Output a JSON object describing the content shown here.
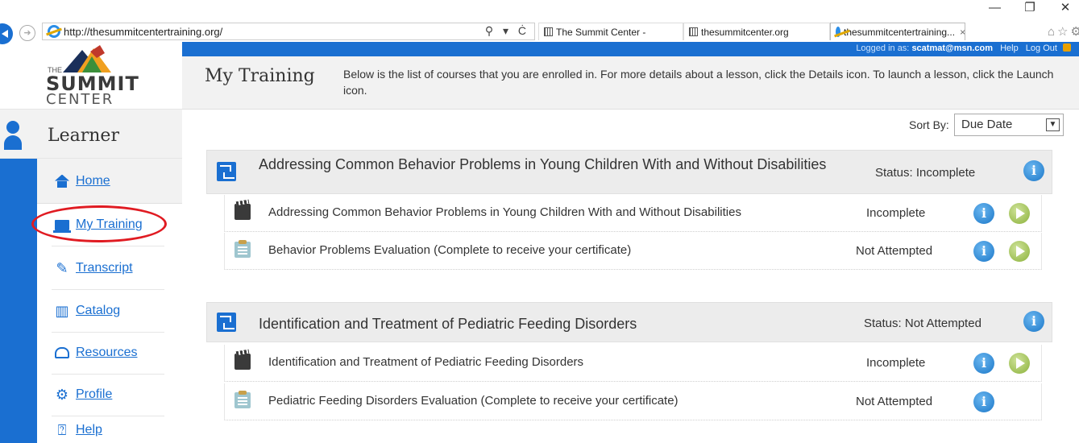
{
  "browser": {
    "url": "http://thesummitcentertraining.org/",
    "tabs": [
      {
        "label": "The Summit Center -"
      },
      {
        "label": "thesummitcenter.org"
      },
      {
        "label": "thesummitcentertraining...",
        "close": "×"
      }
    ],
    "window_controls": {
      "minimize": "—",
      "restore": "❐",
      "close": "✕"
    },
    "address_tools": "⚲ ▾ Ċ",
    "toolbar_icons": "⌂☆⚙"
  },
  "topbar": {
    "logged_in_prefix": "Logged in as: ",
    "user_email": "scatmat@msn.com",
    "help": "Help",
    "logout": "Log Out"
  },
  "logo": {
    "the": "THE",
    "summit": "SUMMIT",
    "center": "CENTER"
  },
  "sidebar": {
    "section_title": "Learner",
    "items": [
      {
        "label": "Home",
        "icon": "house-icon"
      },
      {
        "label": "My Training",
        "icon": "laptop-icon"
      },
      {
        "label": "Transcript",
        "icon": "transcript-icon"
      },
      {
        "label": "Catalog",
        "icon": "catalog-icon"
      },
      {
        "label": "Resources",
        "icon": "cloud-icon"
      },
      {
        "label": "Profile",
        "icon": "gear-icon"
      },
      {
        "label": "Help",
        "icon": "help-icon"
      }
    ]
  },
  "page": {
    "title": "My Training",
    "description": "Below is the list of courses that you are enrolled in. For more details about a lesson, click the Details icon. To launch a lesson, click the Launch icon.",
    "sort_label": "Sort By:",
    "sort_value": "Due Date"
  },
  "courses": [
    {
      "title": "Addressing Common Behavior Problems in Young Children With and Without Disabilities",
      "status": "Status: Incomplete",
      "lessons": [
        {
          "title": "Addressing Common Behavior Problems in Young Children With and Without Disabilities",
          "status": "Incomplete",
          "type": "video",
          "launch": true
        },
        {
          "title": "Behavior Problems Evaluation (Complete to receive your certificate)",
          "status": "Not Attempted",
          "type": "evaluation",
          "launch": true
        }
      ]
    },
    {
      "title": "Identification and Treatment of Pediatric Feeding Disorders",
      "status": "Status: Not Attempted",
      "lessons": [
        {
          "title": "Identification and Treatment of Pediatric Feeding Disorders",
          "status": "Incomplete",
          "type": "video",
          "launch": true
        },
        {
          "title": "Pediatric Feeding Disorders Evaluation (Complete to receive your certificate)",
          "status": "Not Attempted",
          "type": "evaluation",
          "launch": false
        }
      ]
    }
  ],
  "colors": {
    "brand_blue": "#1a6fd1",
    "highlight_red": "#e01b22"
  }
}
